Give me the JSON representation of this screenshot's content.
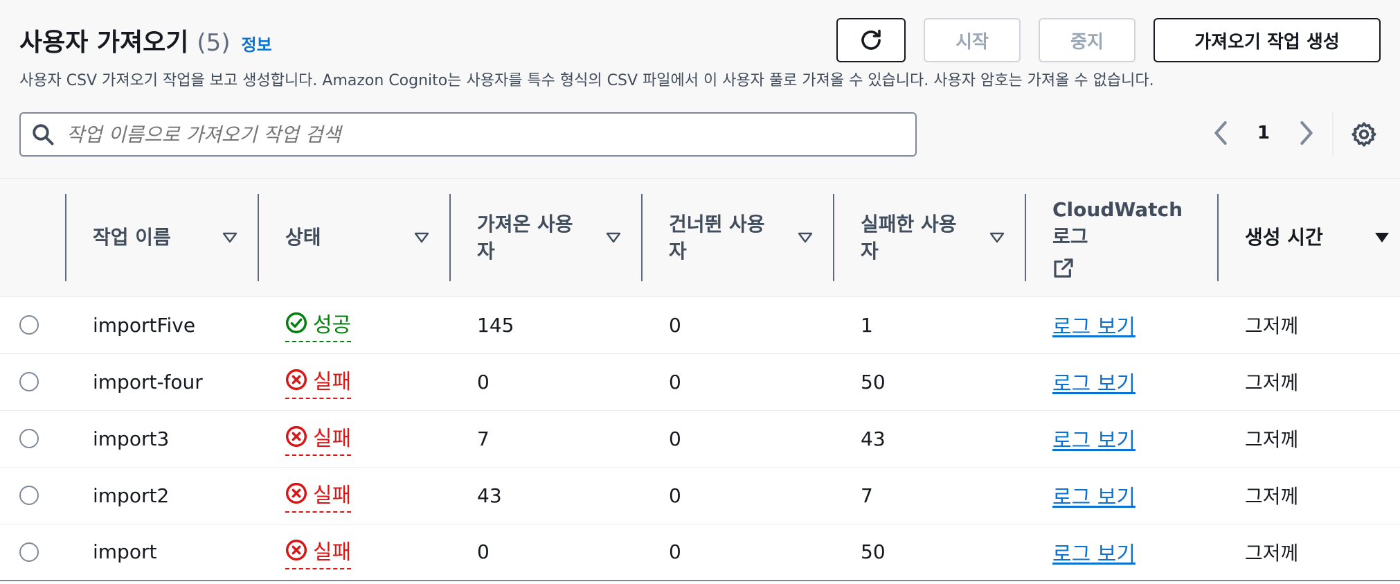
{
  "header": {
    "title": "사용자 가져오기",
    "count": "(5)",
    "info_label": "정보",
    "description": "사용자 CSV 가져오기 작업을 보고 생성합니다. Amazon Cognito는 사용자를 특수 형식의 CSV 파일에서 이 사용자 풀로 가져올 수 있습니다. 사용자 암호는 가져올 수 없습니다."
  },
  "actions": {
    "refresh_icon": "refresh-icon",
    "start_label": "시작",
    "stop_label": "중지",
    "create_label": "가져오기 작업 생성"
  },
  "search": {
    "placeholder": "작업 이름으로 가져오기 작업 검색",
    "value": ""
  },
  "pagination": {
    "current_page": "1"
  },
  "colors": {
    "success": "#037f0c",
    "failed": "#d91515",
    "link": "#0972d3"
  },
  "table": {
    "columns": {
      "job_name": "작업 이름",
      "status": "상태",
      "imported": "가져온 사용자",
      "skipped": "건너뛴 사용자",
      "failed": "실패한 사용자",
      "cloudwatch": "CloudWatch 로그",
      "created": "생성 시간"
    },
    "rows": [
      {
        "job_name": "importFive",
        "status": "성공",
        "status_type": "success",
        "imported": "145",
        "skipped": "0",
        "failed": "1",
        "log_label": "로그 보기",
        "created": "그저께"
      },
      {
        "job_name": "import-four",
        "status": "실패",
        "status_type": "failed",
        "imported": "0",
        "skipped": "0",
        "failed": "50",
        "log_label": "로그 보기",
        "created": "그저께"
      },
      {
        "job_name": "import3",
        "status": "실패",
        "status_type": "failed",
        "imported": "7",
        "skipped": "0",
        "failed": "43",
        "log_label": "로그 보기",
        "created": "그저께"
      },
      {
        "job_name": "import2",
        "status": "실패",
        "status_type": "failed",
        "imported": "43",
        "skipped": "0",
        "failed": "7",
        "log_label": "로그 보기",
        "created": "그저께"
      },
      {
        "job_name": "import",
        "status": "실패",
        "status_type": "failed",
        "imported": "0",
        "skipped": "0",
        "failed": "50",
        "log_label": "로그 보기",
        "created": "그저께"
      }
    ]
  }
}
